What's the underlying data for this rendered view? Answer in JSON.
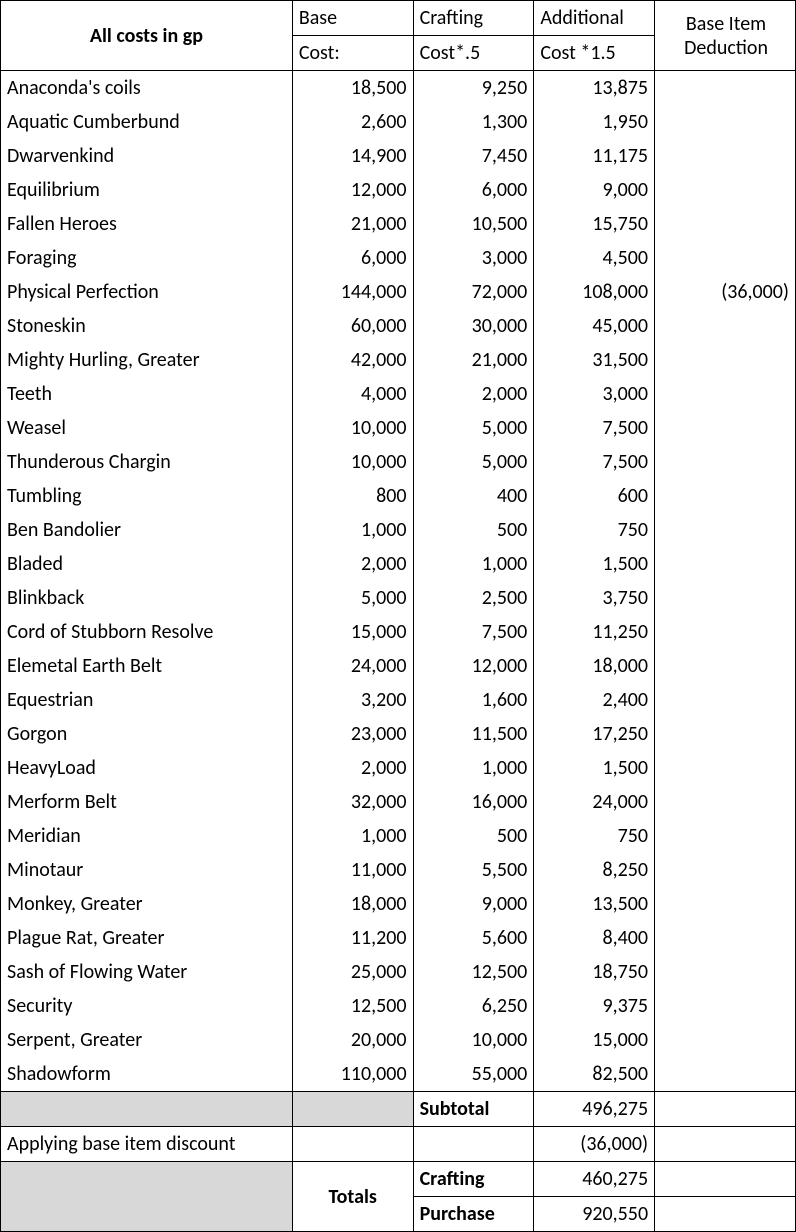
{
  "header": {
    "title": "All costs in gp",
    "base_top": "Base",
    "base_bot": "Cost:",
    "craft_top": "Crafting",
    "craft_bot": "Cost*.5",
    "add_top": "Additional",
    "add_bot": "Cost *1.5",
    "ded_top": "Base Item",
    "ded_bot": "Deduction"
  },
  "rows": [
    {
      "name": "Anaconda's coils",
      "base": "18,500",
      "craft": "9,250",
      "add": "13,875",
      "ded": ""
    },
    {
      "name": "Aquatic Cumberbund",
      "base": "2,600",
      "craft": "1,300",
      "add": "1,950",
      "ded": ""
    },
    {
      "name": "Dwarvenkind",
      "base": "14,900",
      "craft": "7,450",
      "add": "11,175",
      "ded": ""
    },
    {
      "name": "Equilibrium",
      "base": "12,000",
      "craft": "6,000",
      "add": "9,000",
      "ded": ""
    },
    {
      "name": "Fallen Heroes",
      "base": "21,000",
      "craft": "10,500",
      "add": "15,750",
      "ded": ""
    },
    {
      "name": "Foraging",
      "base": "6,000",
      "craft": "3,000",
      "add": "4,500",
      "ded": ""
    },
    {
      "name": "Physical Perfection",
      "base": "144,000",
      "craft": "72,000",
      "add": "108,000",
      "ded": "(36,000)"
    },
    {
      "name": "Stoneskin",
      "base": "60,000",
      "craft": "30,000",
      "add": "45,000",
      "ded": ""
    },
    {
      "name": "Mighty Hurling, Greater",
      "base": "42,000",
      "craft": "21,000",
      "add": "31,500",
      "ded": ""
    },
    {
      "name": "Teeth",
      "base": "4,000",
      "craft": "2,000",
      "add": "3,000",
      "ded": ""
    },
    {
      "name": "Weasel",
      "base": "10,000",
      "craft": "5,000",
      "add": "7,500",
      "ded": ""
    },
    {
      "name": "Thunderous Chargin",
      "base": "10,000",
      "craft": "5,000",
      "add": "7,500",
      "ded": ""
    },
    {
      "name": "Tumbling",
      "base": "800",
      "craft": "400",
      "add": "600",
      "ded": ""
    },
    {
      "name": "Ben Bandolier",
      "base": "1,000",
      "craft": "500",
      "add": "750",
      "ded": ""
    },
    {
      "name": "Bladed",
      "base": "2,000",
      "craft": "1,000",
      "add": "1,500",
      "ded": ""
    },
    {
      "name": "Blinkback",
      "base": "5,000",
      "craft": "2,500",
      "add": "3,750",
      "ded": ""
    },
    {
      "name": "Cord of Stubborn Resolve",
      "base": "15,000",
      "craft": "7,500",
      "add": "11,250",
      "ded": ""
    },
    {
      "name": "Elemetal Earth Belt",
      "base": "24,000",
      "craft": "12,000",
      "add": "18,000",
      "ded": ""
    },
    {
      "name": "Equestrian",
      "base": "3,200",
      "craft": "1,600",
      "add": "2,400",
      "ded": ""
    },
    {
      "name": "Gorgon",
      "base": "23,000",
      "craft": "11,500",
      "add": "17,250",
      "ded": ""
    },
    {
      "name": "HeavyLoad",
      "base": "2,000",
      "craft": "1,000",
      "add": "1,500",
      "ded": ""
    },
    {
      "name": "Merform Belt",
      "base": "32,000",
      "craft": "16,000",
      "add": "24,000",
      "ded": ""
    },
    {
      "name": "Meridian",
      "base": "1,000",
      "craft": "500",
      "add": "750",
      "ded": ""
    },
    {
      "name": "Minotaur",
      "base": "11,000",
      "craft": "5,500",
      "add": "8,250",
      "ded": ""
    },
    {
      "name": "Monkey, Greater",
      "base": "18,000",
      "craft": "9,000",
      "add": "13,500",
      "ded": ""
    },
    {
      "name": "Plague Rat, Greater",
      "base": "11,200",
      "craft": "5,600",
      "add": "8,400",
      "ded": ""
    },
    {
      "name": "Sash of Flowing Water",
      "base": "25,000",
      "craft": "12,500",
      "add": "18,750",
      "ded": ""
    },
    {
      "name": "Security",
      "base": "12,500",
      "craft": "6,250",
      "add": "9,375",
      "ded": ""
    },
    {
      "name": "Serpent, Greater",
      "base": "20,000",
      "craft": "10,000",
      "add": "15,000",
      "ded": ""
    },
    {
      "name": "Shadowform",
      "base": "110,000",
      "craft": "55,000",
      "add": "82,500",
      "ded": ""
    }
  ],
  "footer": {
    "subtotal_label": "Subtotal",
    "subtotal_value": "496,275",
    "discount_label": "Applying base item discount",
    "discount_value": "(36,000)",
    "totals_label": "Totals",
    "crafting_label": "Crafting",
    "crafting_value": "460,275",
    "purchase_label": "Purchase",
    "purchase_value": "920,550"
  }
}
